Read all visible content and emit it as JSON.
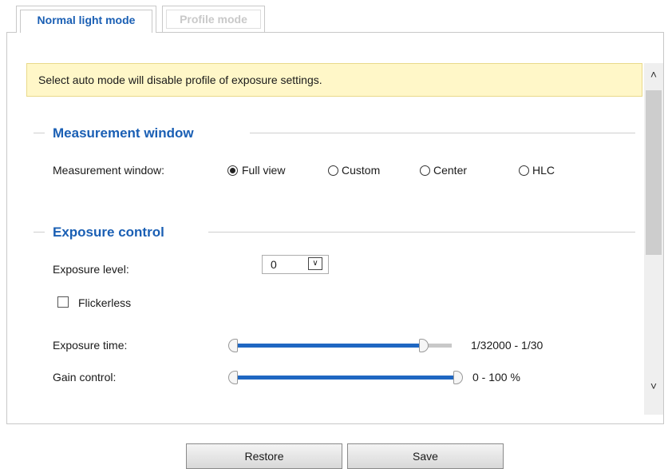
{
  "tabs": [
    {
      "label": "Normal light mode",
      "active": true
    },
    {
      "label": "Profile mode",
      "active": false
    }
  ],
  "notice": "Select auto mode will disable profile of exposure settings.",
  "measurement": {
    "section_title": "Measurement window",
    "label": "Measurement window:",
    "options": [
      "Full view",
      "Custom",
      "Center",
      "HLC"
    ],
    "selected": "Full view"
  },
  "exposure": {
    "section_title": "Exposure control",
    "level_label": "Exposure level:",
    "level_value": "0",
    "flickerless_label": "Flickerless",
    "flickerless_checked": false,
    "time_label": "Exposure time:",
    "time_value": "1/32000 - 1/30",
    "time_range_fraction": [
      0.0,
      0.84
    ],
    "gain_label": "Gain control:",
    "gain_value": "0 - 100 %",
    "gain_range_percent": [
      0,
      100
    ]
  },
  "buttons": {
    "restore": "Restore",
    "save": "Save"
  },
  "icons": {
    "scroll_up": "chevron-up-icon",
    "scroll_down": "chevron-down-icon",
    "dropdown": "chevron-down-icon"
  },
  "colors": {
    "accent": "#1a5fb4",
    "slider_fill": "#1f67c2",
    "notice_bg": "#fff7c8"
  }
}
